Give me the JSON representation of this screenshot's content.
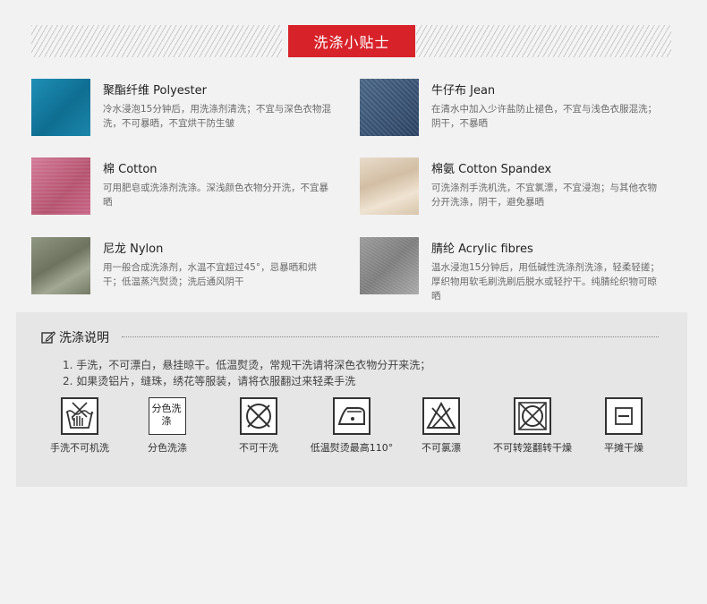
{
  "header": {
    "title": "洗涤小贴士"
  },
  "fabrics": [
    {
      "name": "聚酯纤维 Polyester",
      "desc": "冷水浸泡15分钟后，用洗涤剂清洗；不宜与深色衣物混洗，不可暴晒，不宜烘干防生皱",
      "swatch": "#1a7fa6"
    },
    {
      "name": "牛仔布 Jean",
      "desc": "在清水中加入少许盐防止褪色，不宜与浅色衣服混洗；阴干，不暴晒",
      "swatch": "#3f5b7c"
    },
    {
      "name": "棉 Cotton",
      "desc": "可用肥皂或洗涤剂洗涤。深浅颜色衣物分开洗，不宜暴晒",
      "swatch": "#c2607f"
    },
    {
      "name": "棉氨 Cotton Spandex",
      "desc": "可洗涤剂手洗机洗，不宜氯漂，不宜浸泡；与其他衣物分开洗涤，阴干，避免暴晒",
      "swatch": "#dfcdb5"
    },
    {
      "name": "尼龙 Nylon",
      "desc": "用一般合成洗涤剂，水温不宜超过45°，忌暴晒和烘干；低温蒸汽熨烫；洗后通风阴干",
      "swatch": "#7d846f"
    },
    {
      "name": "腈纶 Acrylic fibres",
      "desc": "温水浸泡15分钟后，用低碱性洗涤剂洗涤，轻柔轻搓；厚织物用软毛刷洗刷后脱水或轻拧干。纯腈纶织物可晾晒",
      "swatch": "#8e8e8e"
    }
  ],
  "instructions": {
    "title": "洗涤说明",
    "notes": [
      "1. 手洗，不可漂白，悬挂晾干。低温熨烫，常规干洗请将深色衣物分开来洗；",
      "2. 如果烫铝片，缝珠，绣花等服装，请将衣服翻过来轻柔手洗"
    ],
    "care_symbols": [
      {
        "icon": "hand-wash-icon",
        "label": "手洗不可机洗"
      },
      {
        "icon": "separate-wash-icon",
        "label": "分色洗涤",
        "icon_text": "分色洗涤"
      },
      {
        "icon": "no-dry-clean-icon",
        "label": "不可干洗"
      },
      {
        "icon": "low-iron-icon",
        "label": "低温熨烫最高110°"
      },
      {
        "icon": "no-bleach-icon",
        "label": "不可氯漂"
      },
      {
        "icon": "no-tumble-dry-icon",
        "label": "不可转笼翻转干燥"
      },
      {
        "icon": "flat-dry-icon",
        "label": "平摊干燥"
      }
    ]
  }
}
